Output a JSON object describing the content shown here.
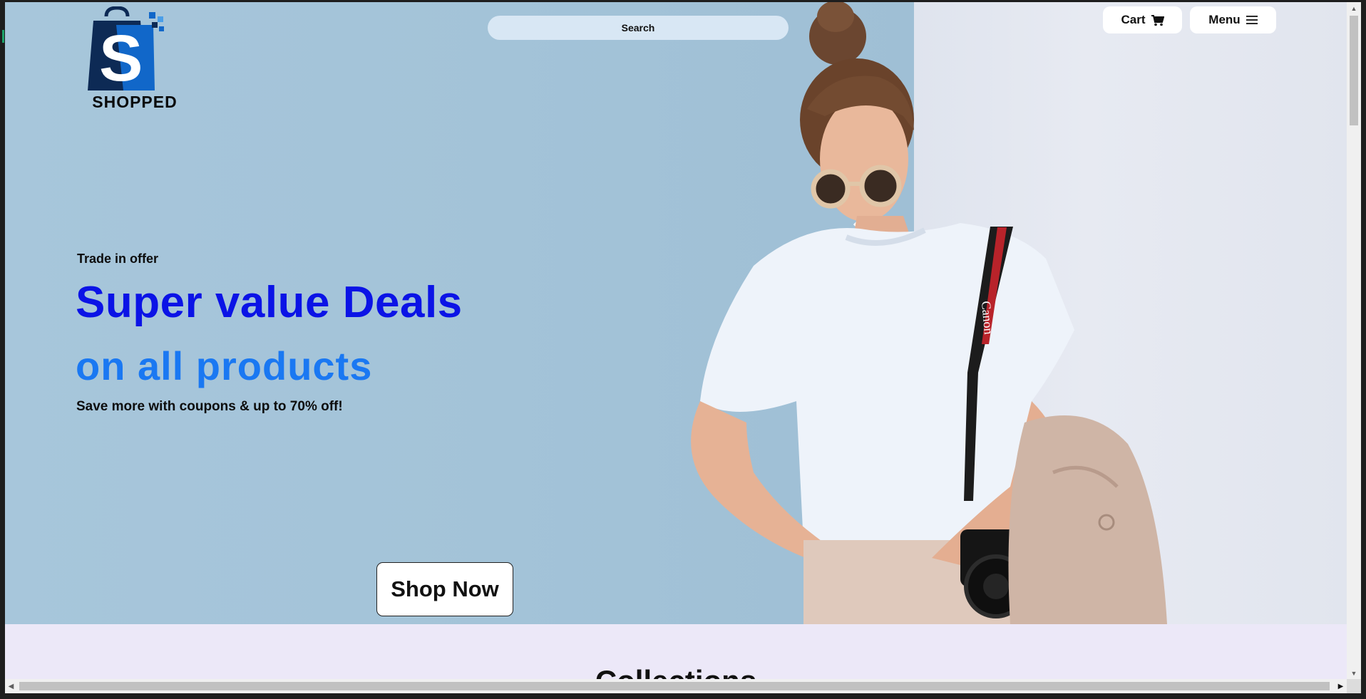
{
  "brand": {
    "name": "SHOPPED",
    "colors": {
      "dark": "#0d2a55",
      "accent": "#1167c9"
    }
  },
  "header": {
    "search_placeholder": "Search",
    "cart_label": "Cart",
    "cart_icon": "cart-icon",
    "menu_label": "Menu",
    "menu_icon": "hamburger-icon"
  },
  "hero": {
    "eyebrow": "Trade in offer",
    "headline_line1": "Super value Deals",
    "headline_line2": "on all products",
    "subtext": "Save more with coupons & up to 70% off!",
    "cta_label": "Shop Now",
    "colors": {
      "headline1": "#0b13e6",
      "headline2": "#1a78f2"
    }
  },
  "collections": {
    "title": "Collections"
  },
  "scrollbars": {
    "up_glyph": "▲",
    "down_glyph": "▼",
    "left_glyph": "◀",
    "right_glyph": "▶"
  }
}
